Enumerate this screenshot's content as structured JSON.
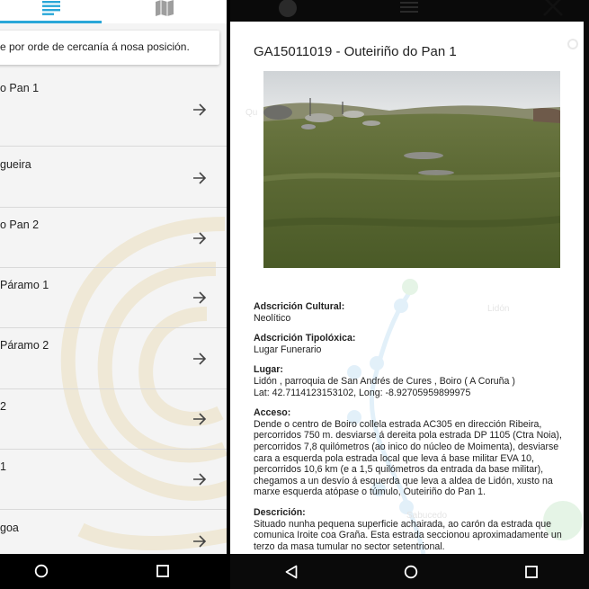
{
  "left": {
    "info": "e por orde de cercanía á nosa posición.",
    "items": [
      {
        "label": "o Pan 1"
      },
      {
        "label": "gueira"
      },
      {
        "label": "o Pan 2"
      },
      {
        "label": "Páramo 1"
      },
      {
        "label": "Páramo 2"
      },
      {
        "label": "2"
      },
      {
        "label": "1"
      },
      {
        "label": "goa"
      }
    ]
  },
  "detail": {
    "title": "GA15011019 - Outeiriño do Pan 1",
    "fields": [
      {
        "heading": "Adscrición Cultural:",
        "text": "Neolítico"
      },
      {
        "heading": "Adscrición Tipolóxica:",
        "text": "Lugar Funerario"
      },
      {
        "heading": "Lugar:",
        "text": "Lidón , parroquia de San Andrés de Cures , Boiro ( A Coruña )\nLat: 42.7114123153102, Long: -8.92705959899975"
      },
      {
        "heading": "Acceso:",
        "text": "Dende o centro de Boiro collela estrada AC305 en dirección Ribeira, percorridos 750 m. desviarse á dereita pola estrada DP 1105 (Ctra Noia), percorridos 7,8 quilómetros (ao inico do núcleo de Moimenta), desviarse cara a esquerda pola estrada local que leva á base militar EVA 10, percorridos 10,6 km (e a 1,5 quilómetros da entrada da base militar), chegamos a un desvío á esquerda que leva a aldea de Lidón, xusto na marxe esquerda atópase o túmulo, Outeiriño do Pan 1."
      },
      {
        "heading": "Descrición:",
        "text": "Situado nunha pequena superficie achairada, ao carón da estrada que comunica Iroite coa Graña. Esta estrada seccionou aproximadamente un terzo da masa tumular no sector setentrional."
      }
    ],
    "map_labels": {
      "a": "Lidón",
      "b": "Sabucedo",
      "c": "Qu"
    }
  },
  "colors": {
    "accent": "#2aa7d8",
    "pin": "#2b8fd6",
    "green_pin": "#3fae49"
  },
  "icons": [
    "list-icon",
    "map-icon",
    "arrow-right-icon",
    "close-icon",
    "nav-home-icon",
    "nav-recents-icon",
    "nav-back-icon"
  ]
}
